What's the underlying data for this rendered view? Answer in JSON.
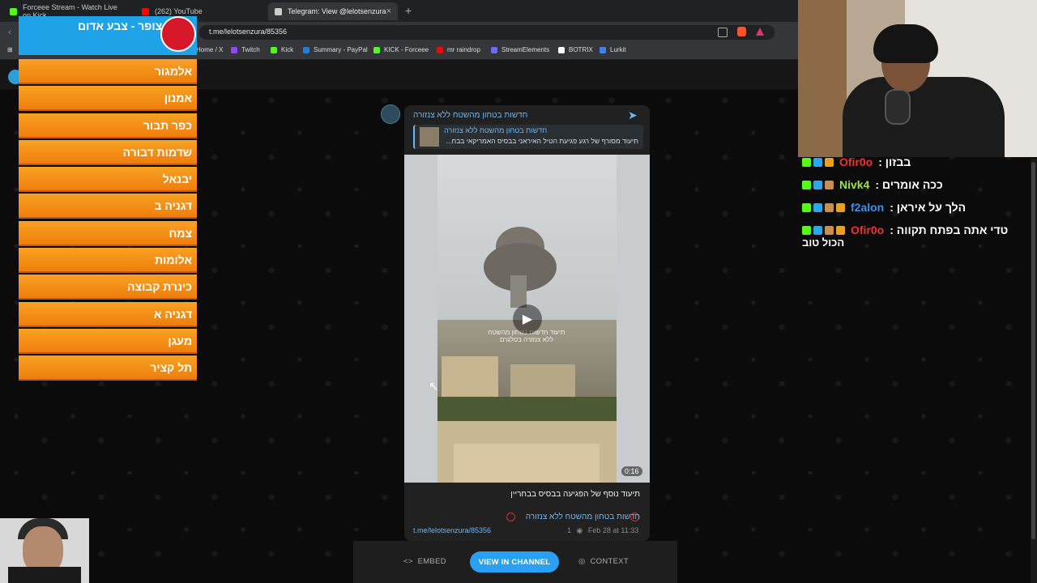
{
  "browser": {
    "tabs": [
      {
        "label": "Forceee Stream - Watch Live on Kick",
        "color": "#53fc18"
      },
      {
        "label": "(262) YouTube",
        "color": "#ff0000"
      },
      {
        "label": "Telegram: View @lelotsenzura",
        "color": "#cccccc"
      }
    ],
    "url": "t.me/lelotsenzura/85356",
    "bookmarks": [
      {
        "label": "Home / X",
        "color": "#ffffff"
      },
      {
        "label": "Twitch",
        "color": "#9146ff"
      },
      {
        "label": "Kick",
        "color": "#53fc18"
      },
      {
        "label": "Summary - PayPal",
        "color": "#1f7fd8"
      },
      {
        "label": "KICK - Forceee",
        "color": "#53fc18"
      },
      {
        "label": "mr raindrop",
        "color": "#ff0000"
      },
      {
        "label": "StreamElements",
        "color": "#6b6bff"
      },
      {
        "label": "BOTRIX",
        "color": "#ffffff"
      },
      {
        "label": "Lurkit",
        "color": "#3b82f6"
      }
    ]
  },
  "post": {
    "channel_name": "חדשות בטחון מהשטח ללא צנזורה",
    "forward_name": "חדשות בטחון מהשטח ללא צנזורה",
    "forward_text": "תיעוד מסורף של רגע פגיעת הטיל האיראני בבסיס האמריקאי בבח...",
    "video_watermark": "תיעוד חדשות בטחון מהשטח ללא צנזורה בטלגרם",
    "duration": "0:16",
    "caption": "תיעוד נוסף של הפגיעה בבסיס בבחריין",
    "signature": "חדשות בטחון מהשטח ללא צנזורה",
    "link": "t.me/lelotsenzura/85356",
    "views": "1",
    "date": "Feb 28 at 11:33"
  },
  "actions": {
    "embed": "EMBED",
    "view": "VIEW IN CHANNEL",
    "context": "CONTEXT"
  },
  "alert": {
    "title": "צופר - צבע אדום",
    "items": [
      "אלמגור",
      "אמנון",
      "כפר תבור",
      "שדמות דבורה",
      "יבנאל",
      "דגניה ב",
      "צמח",
      "אלומות",
      "כינרת קבוצה",
      "דגניה א",
      "מעגן",
      "תל קציר"
    ]
  },
  "chat": {
    "messages": [
      {
        "user": "Ofir0o",
        "user_color": "#e33",
        "text": ": בבזון"
      },
      {
        "user": "Nivk4",
        "user_color": "#9be34a",
        "text": ": ככה אומרים"
      },
      {
        "user": "f2alon",
        "user_color": "#3f8ee8",
        "text": ": הלך על איראן"
      },
      {
        "user": "Ofir0o",
        "user_color": "#e33",
        "text": ": טדי אתה בפתח תקווה"
      }
    ],
    "wrap": "הכול טוב"
  }
}
